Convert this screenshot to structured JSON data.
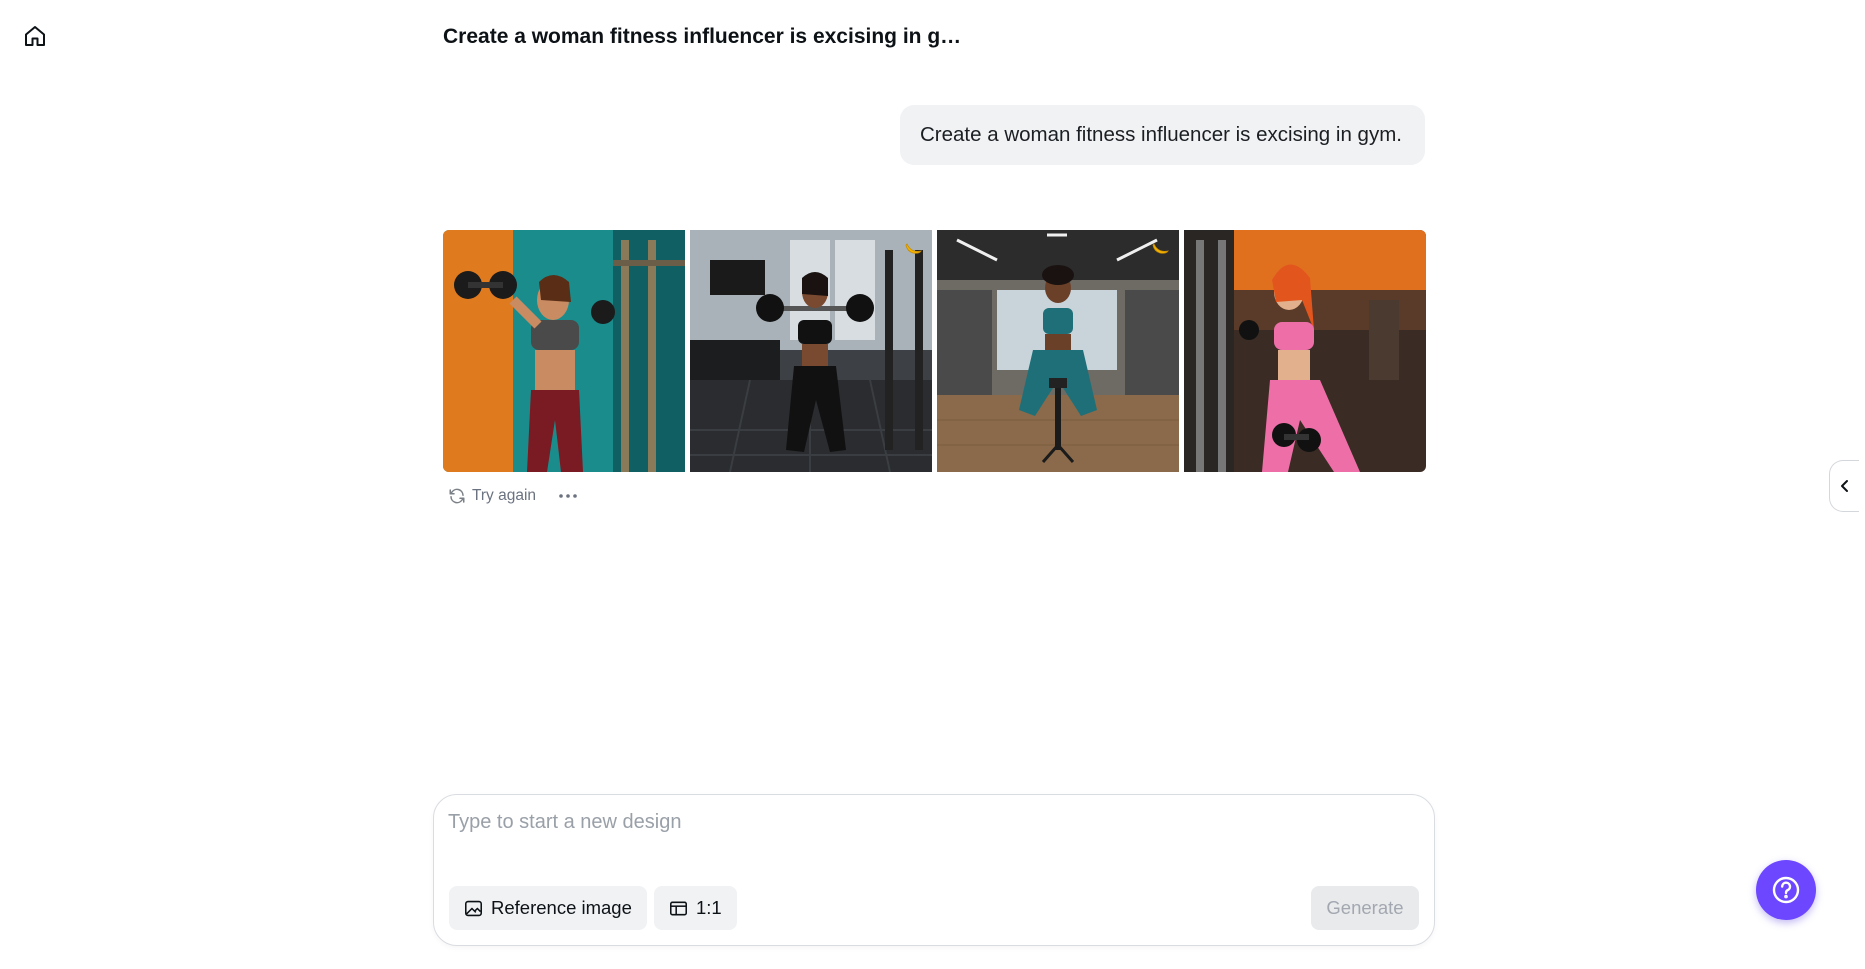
{
  "header": {
    "title": "Create a woman fitness influencer is excising in g…"
  },
  "nav": {
    "home_icon": "home-icon"
  },
  "conversation": {
    "user_prompt": "Create a woman fitness influencer is excising in gym."
  },
  "results": {
    "images": [
      {
        "description_icon": "image-thumbnail",
        "has_badge": false
      },
      {
        "description_icon": "image-thumbnail",
        "has_badge": true
      },
      {
        "description_icon": "image-thumbnail",
        "has_badge": true
      },
      {
        "description_icon": "image-thumbnail",
        "has_badge": false
      }
    ],
    "try_again_label": "Try again",
    "more_icon": "ellipsis-icon"
  },
  "composer": {
    "placeholder": "Type to start a new design",
    "reference_label": "Reference image",
    "ratio_label": "1:1",
    "generate_label": "Generate"
  },
  "colors": {
    "accent": "#6c47ff",
    "bubble": "#f1f2f4",
    "muted_text": "#6b7280",
    "badge": "#f5b400"
  }
}
